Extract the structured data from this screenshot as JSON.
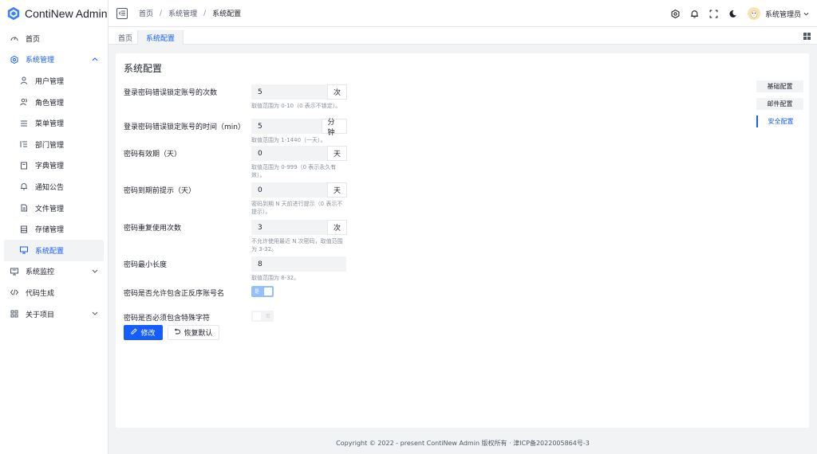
{
  "app": {
    "title": "ContiNew Admin"
  },
  "sidebar": {
    "items": [
      {
        "label": "首页",
        "icon": "dashboard-icon"
      },
      {
        "label": "系统管理",
        "icon": "settings-icon"
      },
      {
        "label": "用户管理",
        "icon": "user-icon"
      },
      {
        "label": "角色管理",
        "icon": "user-group-icon"
      },
      {
        "label": "菜单管理",
        "icon": "menu-icon"
      },
      {
        "label": "部门管理",
        "icon": "tree-list-icon"
      },
      {
        "label": "字典管理",
        "icon": "bookmark-icon"
      },
      {
        "label": "通知公告",
        "icon": "bell-icon"
      },
      {
        "label": "文件管理",
        "icon": "file-icon"
      },
      {
        "label": "存储管理",
        "icon": "storage-icon"
      },
      {
        "label": "系统配置",
        "icon": "desktop-icon"
      },
      {
        "label": "系统监控",
        "icon": "computer-icon"
      },
      {
        "label": "代码生成",
        "icon": "code-icon"
      },
      {
        "label": "关于项目",
        "icon": "apps-icon"
      }
    ]
  },
  "header": {
    "breadcrumb": [
      "首页",
      "系统管理",
      "系统配置"
    ],
    "username": "系统管理员",
    "icons": [
      "settings-icon",
      "bell-icon",
      "fullscreen-icon",
      "moon-icon"
    ]
  },
  "tabs": [
    {
      "label": "首页"
    },
    {
      "label": "系统配置"
    }
  ],
  "page": {
    "title": "系统配置",
    "fields": [
      {
        "label": "登录密码错误锁定账号的次数",
        "value": "5",
        "unit": "次",
        "help": "取值范围为 0-10（0 表示不锁定）。"
      },
      {
        "label": "登录密码错误锁定账号的时间（min）",
        "value": "5",
        "unit": "分钟",
        "help": "取值范围为 1-1440（一天）。"
      },
      {
        "label": "密码有效期（天）",
        "value": "0",
        "unit": "天",
        "help": "取值范围为 0-999（0 表示永久有效）。"
      },
      {
        "label": "密码到期前提示（天）",
        "value": "0",
        "unit": "天",
        "help": "密码到期 N 天前进行提示（0 表示不提示）。"
      },
      {
        "label": "密码重复使用次数",
        "value": "3",
        "unit": "次",
        "help": "不允许使用最近 N 次密码，取值范围为 3-32。"
      },
      {
        "label": "密码最小长度",
        "value": "8",
        "unit": "",
        "help": "取值范围为 8-32。"
      }
    ],
    "switches": [
      {
        "label": "密码是否允许包含正反序账号名",
        "on": true,
        "text": "是"
      },
      {
        "label": "密码是否必须包含特殊字符",
        "on": false,
        "text": "否"
      }
    ],
    "buttons": {
      "edit": "修改",
      "reset": "恢复默认"
    },
    "anchors": [
      "基础配置",
      "邮件配置",
      "安全配置"
    ]
  },
  "footer": "Copyright © 2022 - present ContiNew Admin 版权所有 · 津ICP备2022005864号-3",
  "colors": {
    "primary": "#165dff",
    "switch_on": "#94bfff",
    "bg": "#f2f3f5"
  }
}
